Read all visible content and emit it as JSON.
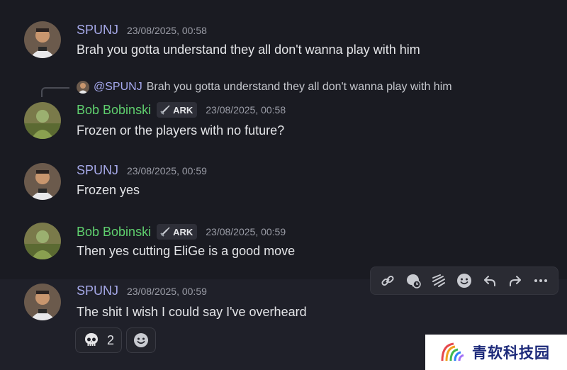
{
  "messages": [
    {
      "user": "SPUNJ",
      "timestamp": "23/08/2025, 00:58",
      "text": "Brah you gotta understand they all don't wanna play with him"
    },
    {
      "user": "Bob Bobinski",
      "badge": "ARK",
      "timestamp": "23/08/2025, 00:58",
      "text": "Frozen or the players with no future?",
      "reply": {
        "mention": "@SPUNJ",
        "text": "Brah you gotta understand they all don't wanna play with him"
      }
    },
    {
      "user": "SPUNJ",
      "timestamp": "23/08/2025, 00:59",
      "text": "Frozen yes"
    },
    {
      "user": "Bob Bobinski",
      "badge": "ARK",
      "timestamp": "23/08/2025, 00:59",
      "text": "Then yes cutting EliGe is a good move"
    },
    {
      "user": "SPUNJ",
      "timestamp": "23/08/2025, 00:59",
      "text": "The shit I wish I could say I've overheard",
      "reactions": [
        {
          "emoji": "skull-icon",
          "count": "2"
        }
      ]
    }
  ],
  "toolbar": {
    "icons": [
      "link-icon",
      "thread-icon",
      "sticker-icon",
      "emoji-icon",
      "reply-icon",
      "forward-icon",
      "more-icon"
    ]
  },
  "watermark": {
    "text": "青软科技园"
  },
  "colors": {
    "background": "#1a1b22",
    "spunj_name": "#a6a9e8",
    "bob_name": "#5fcf6e",
    "mention": "#a7aaf0"
  }
}
